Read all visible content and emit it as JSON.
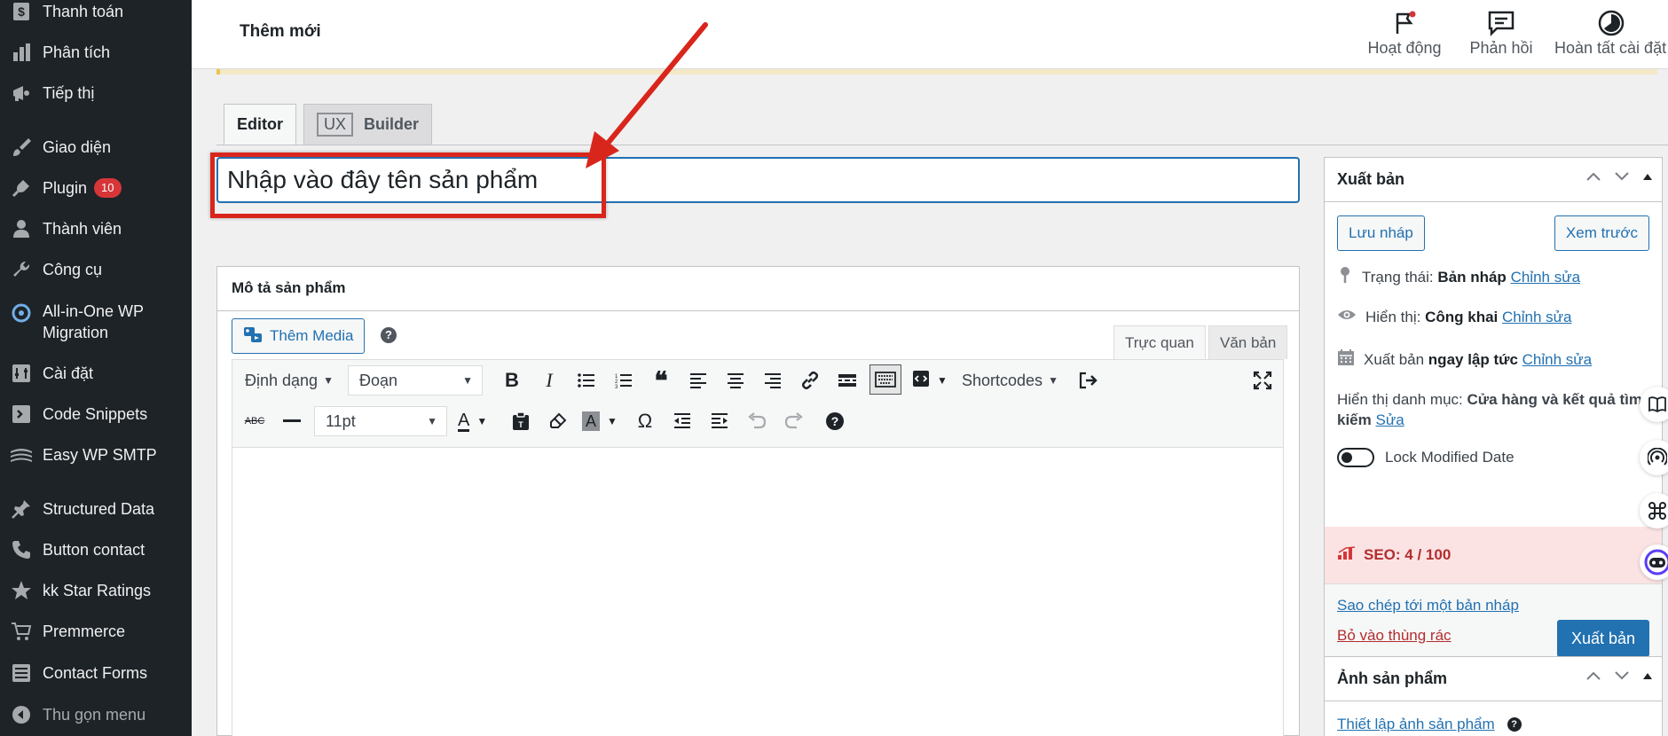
{
  "sidebar": {
    "items": [
      {
        "label": "Thanh toán",
        "icon": "dollar-icon"
      },
      {
        "label": "Phân tích",
        "icon": "bar-chart-icon"
      },
      {
        "label": "Tiếp thị",
        "icon": "megaphone-icon"
      },
      {
        "label": "Giao diện",
        "icon": "brush-icon"
      },
      {
        "label": "Plugin",
        "icon": "plug-icon",
        "badge": "10"
      },
      {
        "label": "Thành viên",
        "icon": "user-icon"
      },
      {
        "label": "Công cụ",
        "icon": "wrench-icon"
      },
      {
        "label": "All-in-One WP",
        "label2": "Migration",
        "icon": "migration-icon"
      },
      {
        "label": "Cài đặt",
        "icon": "settings-icon"
      },
      {
        "label": "Code Snippets",
        "icon": "code-icon"
      },
      {
        "label": "Easy WP SMTP",
        "icon": "mail-icon"
      },
      {
        "label": "Structured Data",
        "icon": "pin-icon"
      },
      {
        "label": "Button contact",
        "icon": "phone-icon"
      },
      {
        "label": "kk Star Ratings",
        "icon": "star-icon"
      },
      {
        "label": "Premmerce",
        "icon": "cart-icon"
      },
      {
        "label": "Contact Forms",
        "icon": "form-icon"
      },
      {
        "label": "Thu gọn menu",
        "icon": "collapse-icon"
      }
    ]
  },
  "topbar": {
    "page_title": "Thêm mới",
    "actions": [
      {
        "label": "Hoạt động",
        "icon": "flag-icon"
      },
      {
        "label": "Phản hồi",
        "icon": "feedback-icon"
      },
      {
        "label": "Hoàn tất cài đặt",
        "icon": "progress-icon"
      }
    ]
  },
  "tabs": {
    "editor": "Editor",
    "ux_badge": "UX",
    "builder": "Builder"
  },
  "title_field": {
    "value": "Nhập vào đây tên sản phẩm"
  },
  "description": {
    "heading": "Mô tả sản phẩm",
    "add_media": "Thêm Media",
    "help": "?",
    "mode_visual": "Trực quan",
    "mode_text": "Văn bản",
    "toolbar": {
      "format_label": "Định dạng",
      "paragraph": "Đoạn",
      "shortcodes": "Shortcodes",
      "font_size": "11pt",
      "strike_abc": "ABC",
      "text_color": "A",
      "bg_color": "A",
      "omega": "Ω",
      "help": "?"
    }
  },
  "publish": {
    "title": "Xuất bản",
    "save_draft": "Lưu nháp",
    "preview": "Xem trước",
    "status_label": "Trạng thái:",
    "status_value": "Bản nháp",
    "edit": "Chỉnh sửa",
    "visibility_label": "Hiển thị:",
    "visibility_value": "Công khai",
    "publish_label": "Xuất bản",
    "publish_value": "ngay lập tức",
    "category_label": "Hiển thị danh mục:",
    "category_value": "Cửa hàng và kết quả tìm kiếm",
    "category_edit": "Sửa",
    "lock_label": "Lock Modified Date",
    "seo": "SEO: 4 / 100",
    "copy_draft": "Sao chép tới một bản nháp",
    "trash": "Bỏ vào thùng rác",
    "publish_button": "Xuất bản"
  },
  "product_image": {
    "title": "Ảnh sản phẩm",
    "set_image": "Thiết lập ảnh sản phẩm",
    "help": "?"
  },
  "colors": {
    "accent": "#2271b1",
    "sidebar": "#1d2327",
    "highlight": "#d9261c",
    "seo_bg": "#fbe3e4"
  }
}
